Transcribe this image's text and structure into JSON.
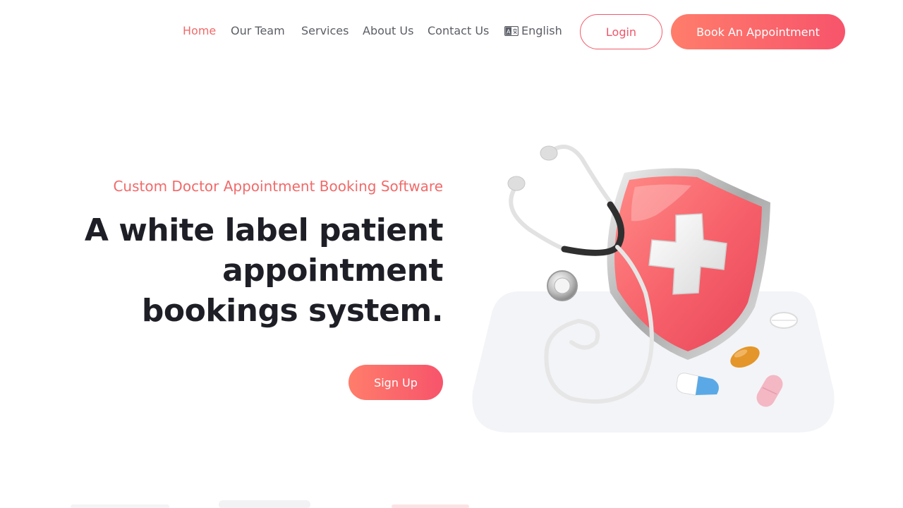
{
  "nav": {
    "links": [
      {
        "label": "Home",
        "active": true
      },
      {
        "label": "Our Team",
        "active": false
      },
      {
        "label": "Services",
        "active": false
      },
      {
        "label": "About Us",
        "active": false
      },
      {
        "label": "Contact Us",
        "active": false
      }
    ],
    "language": {
      "label": "English",
      "icon": "language-icon"
    },
    "login_label": "Login",
    "book_label": "Book An Appointment"
  },
  "hero": {
    "eyebrow": "Custom Doctor Appointment Booking Software",
    "headline_lines": [
      "A white label patient",
      "appointment",
      "bookings system."
    ],
    "signup_label": "Sign Up"
  },
  "illustration": {
    "icons": [
      "shield-cross-icon",
      "stethoscope-icon",
      "pill-icon"
    ]
  },
  "colors": {
    "accent": "#f16a6a",
    "gradient_start": "#ff7d6b",
    "gradient_end": "#f7546b",
    "heading": "#1e1f26",
    "nav_text": "#5b5e66"
  }
}
